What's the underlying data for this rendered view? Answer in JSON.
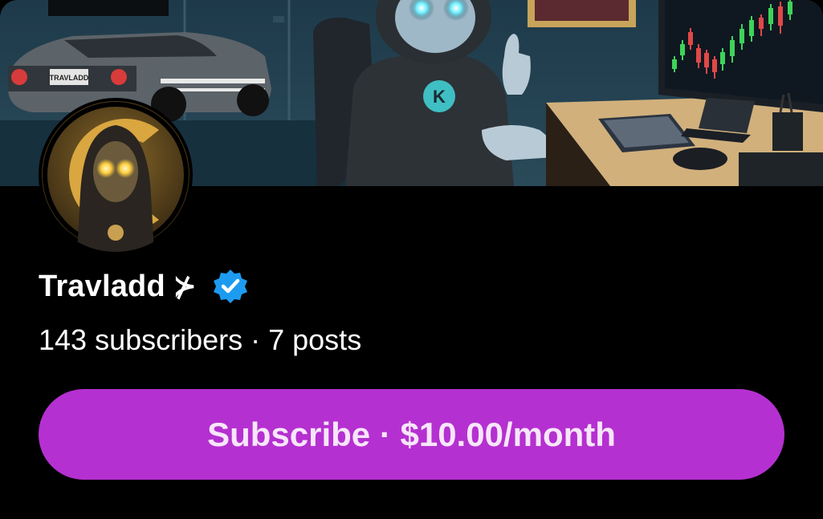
{
  "profile": {
    "name": "Travladd",
    "name_glyph": "⊁",
    "subscribers_text": "143 subscribers · 7 posts",
    "verified_color": "#1d9bf0"
  },
  "subscribe": {
    "label": "Subscribe · $10.00/month",
    "color": "#b530d0"
  },
  "banner": {
    "license_plate": "TRAVLADD"
  }
}
